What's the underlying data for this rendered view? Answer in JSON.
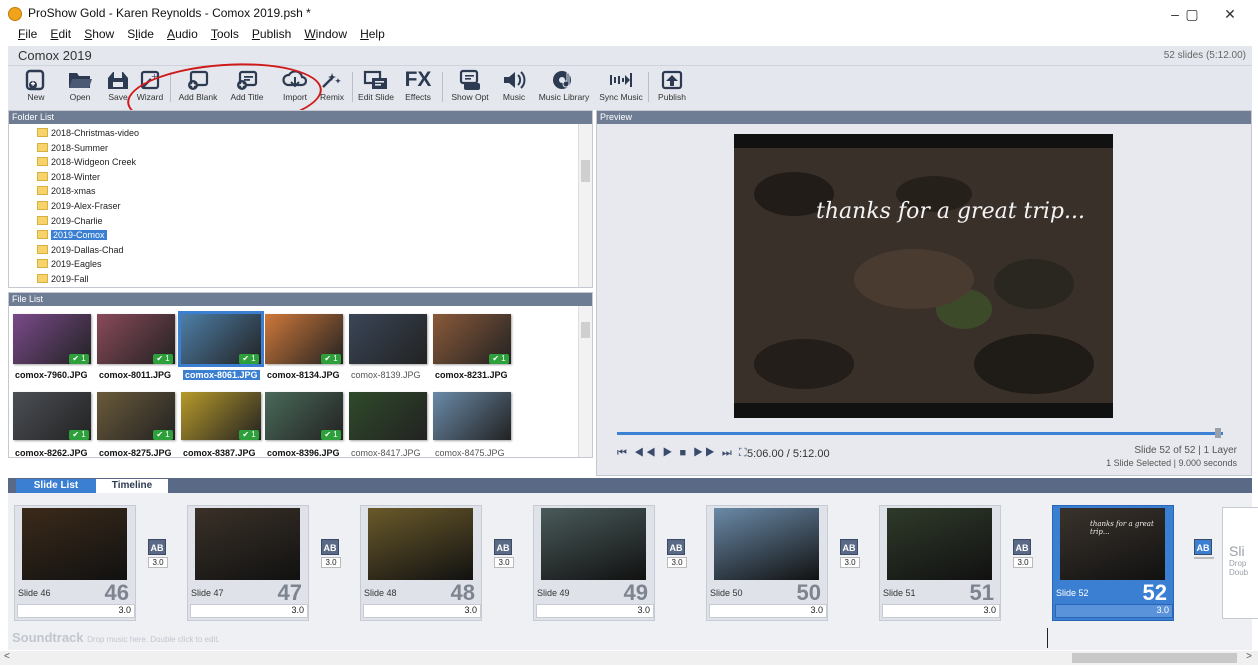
{
  "window": {
    "title": "ProShow Gold - Karen Reynolds - Comox 2019.psh *",
    "minimize": "–",
    "maximize": "▢",
    "close": "✕"
  },
  "menu": [
    {
      "label": "File",
      "u": "F",
      "rest": "ile"
    },
    {
      "label": "Edit",
      "u": "E",
      "rest": "dit"
    },
    {
      "label": "Show",
      "u": "S",
      "rest": "how"
    },
    {
      "label": "Slide",
      "u": "l",
      "rest": "ide",
      "pre": "S"
    },
    {
      "label": "Audio",
      "u": "A",
      "rest": "udio"
    },
    {
      "label": "Tools",
      "u": "T",
      "rest": "ools"
    },
    {
      "label": "Publish",
      "u": "P",
      "rest": "ublish"
    },
    {
      "label": "Window",
      "u": "W",
      "rest": "indow"
    },
    {
      "label": "Help",
      "u": "H",
      "rest": "elp"
    }
  ],
  "show": {
    "name": "Comox 2019",
    "slide_count": "52 slides (5:12.00)"
  },
  "toolbar": {
    "new": "New",
    "open": "Open",
    "save": "Save",
    "wizard": "Wizard",
    "add_blank": "Add Blank",
    "add_title": "Add Title",
    "import": "Import",
    "remix": "Remix",
    "edit_slide": "Edit Slide",
    "effects": "Effects",
    "effects_glyph": "FX",
    "show_opt": "Show Opt",
    "music": "Music",
    "music_library": "Music Library",
    "sync_music": "Sync Music",
    "publish": "Publish"
  },
  "folder_list": {
    "header": "Folder List",
    "items": [
      "2018-Christmas-video",
      "2018-Summer",
      "2018-Widgeon Creek",
      "2018-Winter",
      "2018-xmas",
      "2019-Alex-Fraser",
      "2019-Charlie",
      "2019-Comox",
      "2019-Dallas-Chad",
      "2019-Eagles",
      "2019-Fall"
    ],
    "selected": "2019-Comox"
  },
  "file_list": {
    "header": "File List",
    "row1": [
      {
        "name": "comox-7960.JPG",
        "used": "✔ 1",
        "color": "#7a4a8a"
      },
      {
        "name": "comox-8011.JPG",
        "used": "✔ 1",
        "color": "#8a4a5a"
      },
      {
        "name": "comox-8061.JPG",
        "used": "✔ 1",
        "color": "#4e7fa8"
      },
      {
        "name": "comox-8134.JPG",
        "used": "✔ 1",
        "color": "#d0783a"
      },
      {
        "name": "comox-8139.JPG",
        "used": "",
        "color": "#3a4658"
      },
      {
        "name": "comox-8231.JPG",
        "used": "✔ 1",
        "color": "#8a5a3a"
      }
    ],
    "row2": [
      {
        "name": "comox-8262.JPG",
        "used": "✔ 1",
        "color": "#4b4f55"
      },
      {
        "name": "comox-8275.JPG",
        "used": "✔ 1",
        "color": "#6a5a3a"
      },
      {
        "name": "comox-8387.JPG",
        "used": "✔ 1",
        "color": "#b79a2a"
      },
      {
        "name": "comox-8396.JPG",
        "used": "✔ 1",
        "color": "#4a6a5a"
      },
      {
        "name": "comox-8417.JPG",
        "used": "",
        "color": "#2f4a2a"
      },
      {
        "name": "comox-8475.JPG",
        "used": "",
        "color": "#6a8aa8"
      }
    ]
  },
  "preview": {
    "header": "Preview",
    "caption": "thanks for a great trip...",
    "time": "5:06.00 / 5:12.00",
    "status_line1": "Slide 52 of 52  |  1 Layer",
    "status_line2": "1 Slide Selected  |  9.000 seconds",
    "transport": "⏮ ◀◀ ▶ ■ ▶▶ ⏭ ⛶"
  },
  "tabs": {
    "slide_list": "Slide List",
    "timeline": "Timeline"
  },
  "slides": [
    {
      "name": "Slide 46",
      "num": "46",
      "duration": "3.0",
      "transition": "3.0",
      "color": "#3b2a1a"
    },
    {
      "name": "Slide 47",
      "num": "47",
      "duration": "3.0",
      "transition": "3.0",
      "color": "#3a3128"
    },
    {
      "name": "Slide 48",
      "num": "48",
      "duration": "3.0",
      "transition": "3.0",
      "color": "#6a5a2a"
    },
    {
      "name": "Slide 49",
      "num": "49",
      "duration": "3.0",
      "transition": "3.0",
      "color": "#4a5a5a"
    },
    {
      "name": "Slide 50",
      "num": "50",
      "duration": "3.0",
      "transition": "3.0",
      "color": "#6a8aa8"
    },
    {
      "name": "Slide 51",
      "num": "51",
      "duration": "3.0",
      "transition": "3.0",
      "color": "#2f3a2a"
    },
    {
      "name": "Slide 52",
      "num": "52",
      "duration": "3.0",
      "transition": "",
      "color": "#3a332c"
    }
  ],
  "transition_icon": "AB",
  "next_slide_partial": {
    "label": "Sli",
    "line1": "Drop",
    "line2": "Doub"
  },
  "slide52_caption": "thanks for a great trip...",
  "soundtrack": {
    "label": "Soundtrack",
    "hint": "Drop music here.  Double click to edit."
  }
}
